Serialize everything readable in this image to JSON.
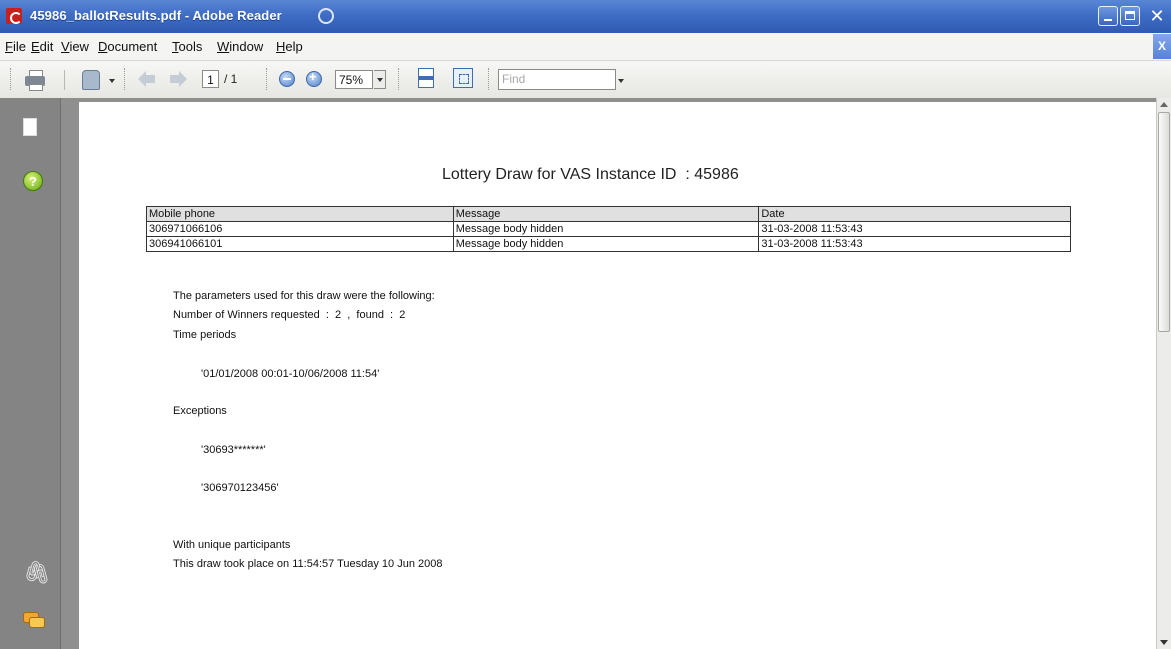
{
  "window": {
    "title": "45986_ballotResults.pdf - Adobe Reader",
    "close_glyph": "✕",
    "doc_close_glyph": "X"
  },
  "menu": {
    "items": [
      {
        "u": "F",
        "rest": "ile"
      },
      {
        "u": "E",
        "rest": "dit"
      },
      {
        "u": "V",
        "rest": "iew"
      },
      {
        "u": "D",
        "rest": "ocument"
      },
      {
        "u": "T",
        "rest": "ools"
      },
      {
        "u": "W",
        "rest": "indow"
      },
      {
        "u": "H",
        "rest": "elp"
      }
    ]
  },
  "toolbar": {
    "page_current": "1",
    "page_total": "/ 1",
    "zoom": "75%",
    "find_placeholder": "Find"
  },
  "nav": {
    "help_glyph": "?",
    "clip_glyph": "🖇"
  },
  "document": {
    "title": "Lottery Draw for VAS Instance ID  : 45986",
    "table": {
      "headers": [
        "Mobile phone",
        "Message",
        "Date"
      ],
      "rows": [
        [
          "306971066106",
          "Message body hidden",
          "31-03-2008 11:53:43"
        ],
        [
          "306941066101",
          "Message body hidden",
          "31-03-2008 11:53:43"
        ]
      ]
    },
    "params_intro": "The parameters used for this draw were the following:",
    "winners_line": "Number of Winners requested  :  2  ,  found  :  2",
    "time_periods_label": "Time periods",
    "time_period_value": "'01/01/2008 00:01-10/06/2008 11:54'",
    "exceptions_label": "Exceptions",
    "exception_1": "'30693*******'",
    "exception_2": "'306970123456'",
    "unique_line": "With unique participants",
    "draw_time_line": "This draw took place on 11:54:57 Tuesday 10 Jun 2008"
  }
}
